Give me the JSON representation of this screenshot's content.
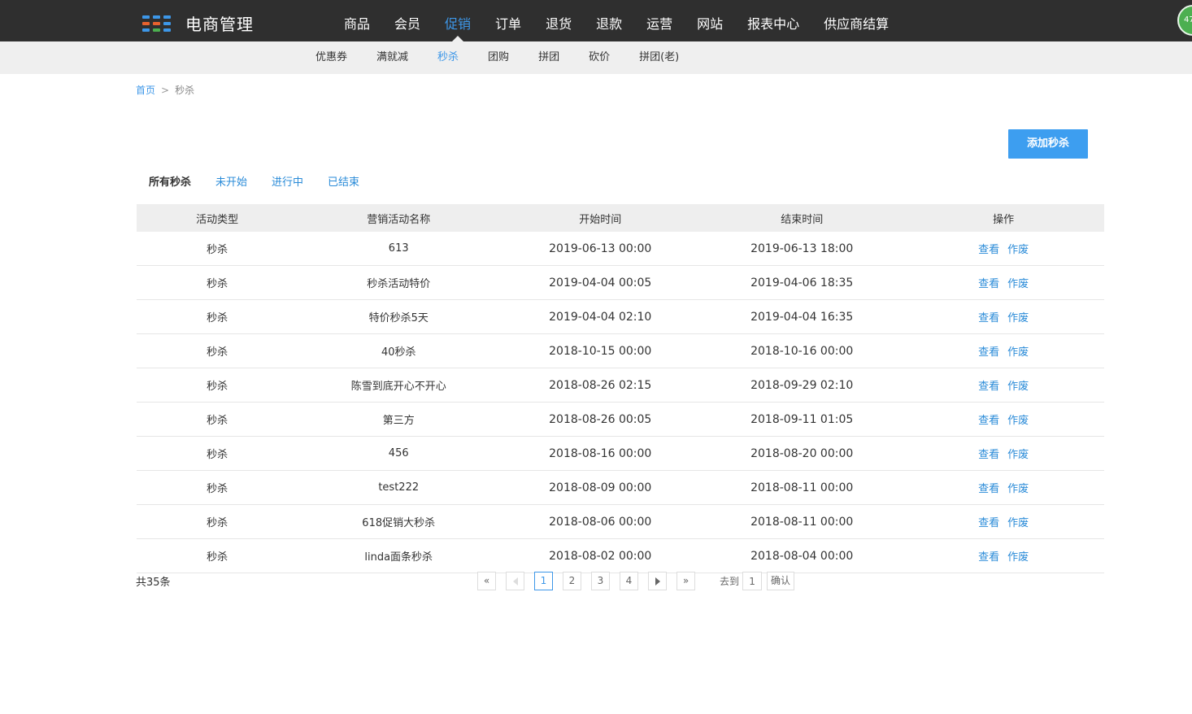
{
  "header": {
    "app_title": "电商管理",
    "logo_colors": [
      "#3d97e8",
      "#3d97e8",
      "#3d97e8",
      "#e8622e",
      "#e8622e",
      "#3d97e8",
      "#3d97e8",
      "#4caf50",
      "#3d97e8"
    ],
    "main_nav": [
      {
        "label": "商品"
      },
      {
        "label": "会员"
      },
      {
        "label": "促销"
      },
      {
        "label": "订单"
      },
      {
        "label": "退货"
      },
      {
        "label": "退款"
      },
      {
        "label": "运营"
      },
      {
        "label": "网站"
      },
      {
        "label": "报表中心"
      },
      {
        "label": "供应商结算"
      }
    ],
    "active_nav": "促销",
    "badge_text": "47",
    "badge_color": "#4caf50"
  },
  "subnav": {
    "items": [
      {
        "label": "优惠券"
      },
      {
        "label": "满就减"
      },
      {
        "label": "秒杀"
      },
      {
        "label": "团购"
      },
      {
        "label": "拼团"
      },
      {
        "label": "砍价"
      },
      {
        "label": "拼团(老)"
      }
    ],
    "active": "秒杀"
  },
  "breadcrumb": {
    "home": "首页",
    "separator": ">",
    "current": "秒杀"
  },
  "toolbar": {
    "add_label": "添加秒杀"
  },
  "filters": {
    "tabs": [
      {
        "label": "所有秒杀"
      },
      {
        "label": "未开始"
      },
      {
        "label": "进行中"
      },
      {
        "label": "已结束"
      }
    ],
    "active": "所有秒杀"
  },
  "table": {
    "headers": [
      "活动类型",
      "营销活动名称",
      "开始时间",
      "结束时间",
      "操作"
    ],
    "rows": [
      {
        "type": "秒杀",
        "name": "613",
        "start": "2019-06-13 00:00",
        "end": "2019-06-13 18:00"
      },
      {
        "type": "秒杀",
        "name": "秒杀活动特价",
        "start": "2019-04-04 00:05",
        "end": "2019-04-06 18:35"
      },
      {
        "type": "秒杀",
        "name": "特价秒杀5天",
        "start": "2019-04-04 02:10",
        "end": "2019-04-04 16:35"
      },
      {
        "type": "秒杀",
        "name": "40秒杀",
        "start": "2018-10-15 00:00",
        "end": "2018-10-16 00:00"
      },
      {
        "type": "秒杀",
        "name": "陈雪到底开心不开心",
        "start": "2018-08-26 02:15",
        "end": "2018-09-29 02:10"
      },
      {
        "type": "秒杀",
        "name": "第三方",
        "start": "2018-08-26 00:05",
        "end": "2018-09-11 01:05"
      },
      {
        "type": "秒杀",
        "name": "456",
        "start": "2018-08-16 00:00",
        "end": "2018-08-20 00:00"
      },
      {
        "type": "秒杀",
        "name": "test222",
        "start": "2018-08-09 00:00",
        "end": "2018-08-11 00:00"
      },
      {
        "type": "秒杀",
        "name": "618促销大秒杀",
        "start": "2018-08-06 00:00",
        "end": "2018-08-11 00:00"
      },
      {
        "type": "秒杀",
        "name": "linda面条秒杀",
        "start": "2018-08-02 00:00",
        "end": "2018-08-04 00:00"
      }
    ],
    "action_view": "查看",
    "action_void": "作废"
  },
  "pagination": {
    "total_text": "共35条",
    "first": "«",
    "last": "»",
    "pages": [
      "1",
      "2",
      "3",
      "4"
    ],
    "current_page": "1",
    "goto_label": "去到",
    "goto_value": "1",
    "confirm_label": "确认"
  }
}
